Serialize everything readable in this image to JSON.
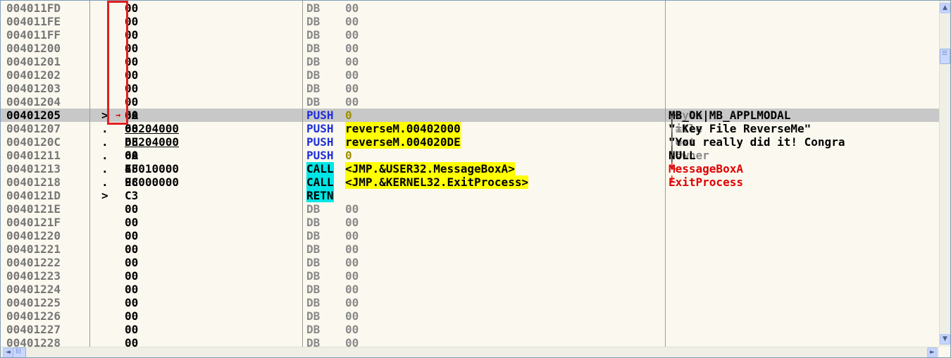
{
  "rows": [
    {
      "addr": "004011FD",
      "jmp": "",
      "hex": "00",
      "mnem": "DB",
      "oper": "00",
      "db": true
    },
    {
      "addr": "004011FE",
      "jmp": "",
      "hex": "00",
      "mnem": "DB",
      "oper": "00",
      "db": true
    },
    {
      "addr": "004011FF",
      "jmp": "",
      "hex": "00",
      "mnem": "DB",
      "oper": "00",
      "db": true
    },
    {
      "addr": "00401200",
      "jmp": "",
      "hex": "00",
      "mnem": "DB",
      "oper": "00",
      "db": true
    },
    {
      "addr": "00401201",
      "jmp": "",
      "hex": "00",
      "mnem": "DB",
      "oper": "00",
      "db": true
    },
    {
      "addr": "00401202",
      "jmp": "",
      "hex": "00",
      "mnem": "DB",
      "oper": "00",
      "db": true
    },
    {
      "addr": "00401203",
      "jmp": "",
      "hex": "00",
      "mnem": "DB",
      "oper": "00",
      "db": true
    },
    {
      "addr": "00401204",
      "jmp": "",
      "hex": "00",
      "mnem": "DB",
      "oper": "00",
      "db": true
    },
    {
      "addr": "00401205",
      "jmp": ">",
      "hex": "6A 00",
      "mnem": "PUSH",
      "oper": "0",
      "sel": true
    },
    {
      "addr": "00401207",
      "jmp": ".",
      "hex": "68 00204000",
      "mnem": "PUSH",
      "oper": "reverseM.00402000"
    },
    {
      "addr": "0040120C",
      "jmp": ".",
      "hex": "68 DE204000",
      "mnem": "PUSH",
      "oper": "reverseM.004020DE"
    },
    {
      "addr": "00401211",
      "jmp": ".",
      "hex": "6A 00",
      "mnem": "PUSH",
      "oper": "0"
    },
    {
      "addr": "00401213",
      "jmp": ".",
      "hex": "E8 4F010000",
      "mnem": "CALL",
      "oper": "<JMP.&USER32.MessageBoxA>"
    },
    {
      "addr": "00401218",
      "jmp": ".",
      "hex": "E8 9C000000",
      "mnem": "CALL",
      "oper": "<JMP.&KERNEL32.ExitProcess>"
    },
    {
      "addr": "0040121D",
      "jmp": ">",
      "hex": "C3",
      "mnem": "RETN",
      "oper": ""
    },
    {
      "addr": "0040121E",
      "jmp": "",
      "hex": "00",
      "mnem": "DB",
      "oper": "00",
      "db": true
    },
    {
      "addr": "0040121F",
      "jmp": "",
      "hex": "00",
      "mnem": "DB",
      "oper": "00",
      "db": true
    },
    {
      "addr": "00401220",
      "jmp": "",
      "hex": "00",
      "mnem": "DB",
      "oper": "00",
      "db": true
    },
    {
      "addr": "00401221",
      "jmp": "",
      "hex": "00",
      "mnem": "DB",
      "oper": "00",
      "db": true
    },
    {
      "addr": "00401222",
      "jmp": "",
      "hex": "00",
      "mnem": "DB",
      "oper": "00",
      "db": true
    },
    {
      "addr": "00401223",
      "jmp": "",
      "hex": "00",
      "mnem": "DB",
      "oper": "00",
      "db": true
    },
    {
      "addr": "00401224",
      "jmp": "",
      "hex": "00",
      "mnem": "DB",
      "oper": "00",
      "db": true
    },
    {
      "addr": "00401225",
      "jmp": "",
      "hex": "00",
      "mnem": "DB",
      "oper": "00",
      "db": true
    },
    {
      "addr": "00401226",
      "jmp": "",
      "hex": "00",
      "mnem": "DB",
      "oper": "00",
      "db": true
    },
    {
      "addr": "00401227",
      "jmp": "",
      "hex": "00",
      "mnem": "DB",
      "oper": "00",
      "db": true
    },
    {
      "addr": "00401228",
      "jmp": "",
      "hex": "00",
      "mnem": "DB",
      "oper": "00",
      "db": true
    }
  ],
  "comments": {
    "r8_bracket": "┌",
    "r8_key": "Style",
    "r8_eq": " = ",
    "r8_val": "MB_OK|MB_APPLMODAL",
    "r9_bracket": "│",
    "r9_key": "Title",
    "r9_eq": " = ",
    "r9_val": "\" Key File ReverseMe\"",
    "r10_bracket": "│",
    "r10_key": "Text",
    "r10_eq": " = ",
    "r10_val": "\"You really did it! Congra",
    "r11_bracket": "│",
    "r11_key": "hOwner",
    "r11_eq": " = ",
    "r11_val": "NULL",
    "r12_bracket": "└",
    "r12_val": "MessageBoxA",
    "r13_bracket": "└",
    "r13_val": "ExitProcess"
  },
  "jump_arrow": "→",
  "scroll": {
    "up": "▲",
    "down": "▼",
    "left": "◄",
    "right": "►",
    "grip": "|||"
  },
  "colors": {
    "background": "#fbf9ef",
    "selected_row": "#c8c8c8",
    "mnemonic_blue": "#1e2fd8",
    "operand_yellow": "#ffff00",
    "call_cyan": "#00e6e6",
    "api_red": "#e00000",
    "highlight_box": "#e02020"
  }
}
